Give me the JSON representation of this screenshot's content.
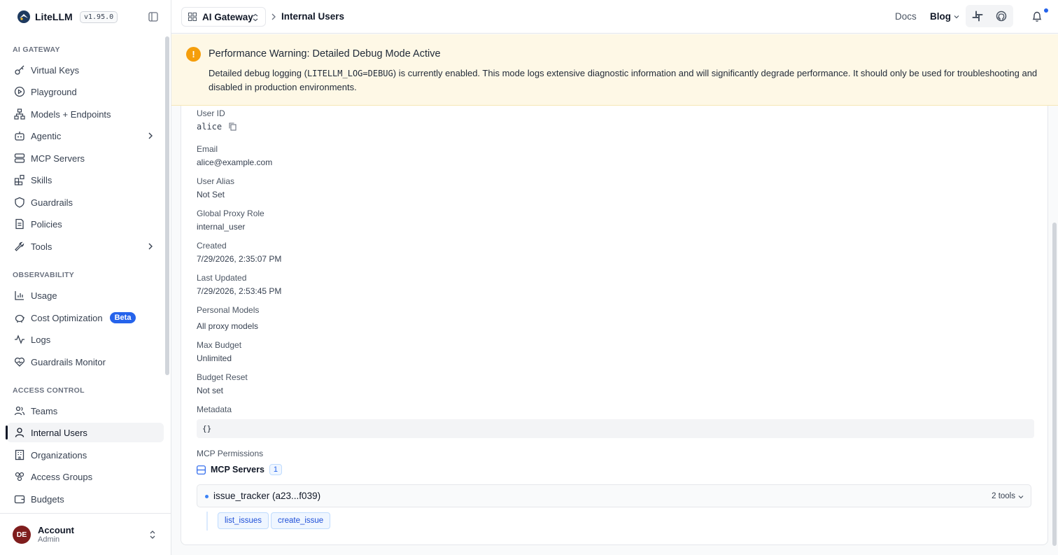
{
  "app": {
    "name": "LiteLLM",
    "version": "v1.95.0"
  },
  "sidebar": {
    "sections": [
      {
        "title": "AI GATEWAY",
        "items": [
          {
            "label": "Virtual Keys",
            "icon": "key-icon"
          },
          {
            "label": "Playground",
            "icon": "play-circle-icon"
          },
          {
            "label": "Models + Endpoints",
            "icon": "nodes-icon"
          },
          {
            "label": "Agentic",
            "icon": "robot-icon",
            "expandable": true
          },
          {
            "label": "MCP Servers",
            "icon": "server-icon"
          },
          {
            "label": "Skills",
            "icon": "blocks-icon"
          },
          {
            "label": "Guardrails",
            "icon": "shield-icon"
          },
          {
            "label": "Policies",
            "icon": "document-icon"
          },
          {
            "label": "Tools",
            "icon": "wrench-icon",
            "expandable": true
          }
        ]
      },
      {
        "title": "OBSERVABILITY",
        "items": [
          {
            "label": "Usage",
            "icon": "bar-chart-icon"
          },
          {
            "label": "Cost Optimization",
            "icon": "piggy-bank-icon",
            "badge": "Beta"
          },
          {
            "label": "Logs",
            "icon": "activity-icon"
          },
          {
            "label": "Guardrails Monitor",
            "icon": "heart-pulse-icon"
          }
        ]
      },
      {
        "title": "ACCESS CONTROL",
        "items": [
          {
            "label": "Teams",
            "icon": "users-icon"
          },
          {
            "label": "Internal Users",
            "icon": "user-icon",
            "active": true
          },
          {
            "label": "Organizations",
            "icon": "building-icon"
          },
          {
            "label": "Access Groups",
            "icon": "access-groups-icon"
          },
          {
            "label": "Budgets",
            "icon": "wallet-icon"
          }
        ]
      }
    ],
    "account": {
      "initials": "DE",
      "name": "Account",
      "role": "Admin"
    }
  },
  "header": {
    "gateway_switch": "AI Gateway",
    "breadcrumb_current": "Internal Users",
    "docs": "Docs",
    "blog": "Blog",
    "icons": [
      "slack-icon",
      "github-icon",
      "bell-icon"
    ]
  },
  "warning": {
    "title": "Performance Warning: Detailed Debug Mode Active",
    "body_before": "Detailed debug logging (",
    "body_code": "LITELLM_LOG=DEBUG",
    "body_after": ") is currently enabled. This mode logs extensive diagnostic information and will significantly degrade performance. It should only be used for troubleshooting and disabled in production environments."
  },
  "user": {
    "fields": {
      "user_id": {
        "label": "User ID",
        "value": "alice"
      },
      "email": {
        "label": "Email",
        "value": "alice@example.com"
      },
      "alias": {
        "label": "User Alias",
        "value": "Not Set"
      },
      "role": {
        "label": "Global Proxy Role",
        "value": "internal_user"
      },
      "created": {
        "label": "Created",
        "value": "7/29/2026, 2:35:07 PM"
      },
      "updated": {
        "label": "Last Updated",
        "value": "7/29/2026, 2:53:45 PM"
      },
      "models": {
        "label": "Personal Models",
        "value": "All proxy models"
      },
      "budget": {
        "label": "Max Budget",
        "value": "Unlimited"
      },
      "reset": {
        "label": "Budget Reset",
        "value": "Not set"
      },
      "metadata": {
        "label": "Metadata",
        "value": "{}"
      }
    },
    "mcp": {
      "label": "MCP Permissions",
      "servers_title": "MCP Servers",
      "servers_count": "1",
      "server": {
        "name": "issue_tracker (a23...f039)",
        "tools_count": "2 tools"
      },
      "tools": [
        "list_issues",
        "create_issue"
      ]
    }
  }
}
